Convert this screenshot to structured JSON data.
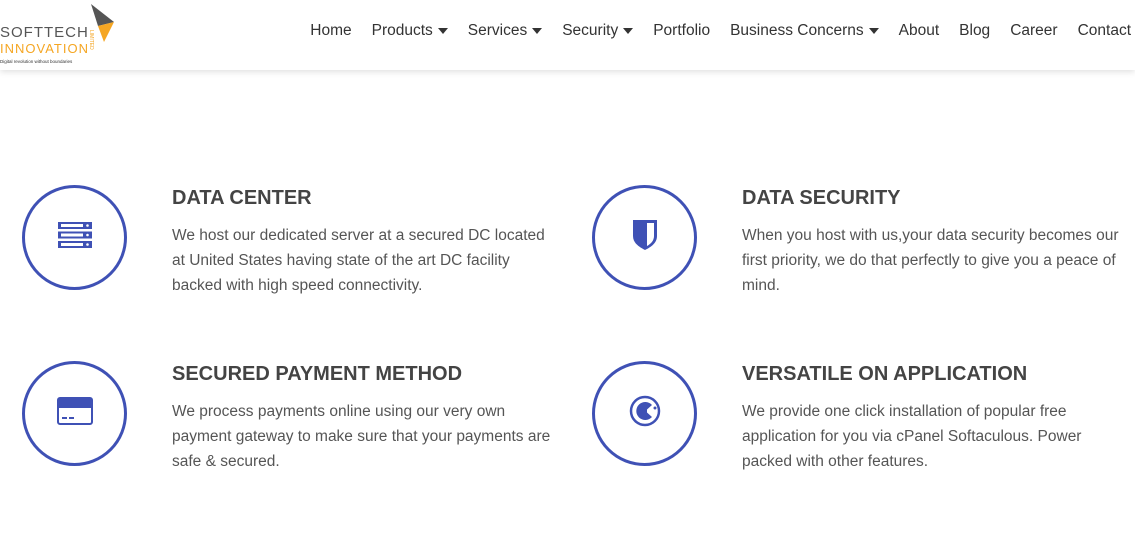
{
  "brand": {
    "name_line1": "SOFTTECH",
    "name_line2": "INNOVATION",
    "suffix": "LIMITED",
    "tagline": "Digital revolution without boundaries",
    "colors": {
      "orange": "#f5a623",
      "gray": "#555555"
    }
  },
  "nav": {
    "items": [
      {
        "label": "Home",
        "dropdown": false
      },
      {
        "label": "Products",
        "dropdown": true
      },
      {
        "label": "Services",
        "dropdown": true
      },
      {
        "label": "Security",
        "dropdown": true
      },
      {
        "label": "Portfolio",
        "dropdown": false
      },
      {
        "label": "Business Concerns",
        "dropdown": true
      },
      {
        "label": "About",
        "dropdown": false
      },
      {
        "label": "Blog",
        "dropdown": false
      },
      {
        "label": "Career",
        "dropdown": false
      },
      {
        "label": "Contact",
        "dropdown": false
      }
    ]
  },
  "accent": "#3f51b5",
  "features": [
    {
      "icon": "server-icon",
      "title": "DATA CENTER",
      "description": "We host our dedicated server at a secured DC located at United States having state of the art DC facility backed with high speed connectivity."
    },
    {
      "icon": "shield-icon",
      "title": "DATA SECURITY",
      "description": "When you host with us,your data security becomes our first priority, we do that perfectly to give you a peace of mind."
    },
    {
      "icon": "credit-card-icon",
      "title": "SECURED PAYMENT METHOD",
      "description": "We process payments online using our very own payment gateway to make sure that your payments are safe & secured."
    },
    {
      "icon": "cpanel-icon",
      "title": "VERSATILE ON APPLICATION",
      "description": "We provide one click installation of popular free application for you via cPanel Softaculous. Power packed with other features."
    }
  ]
}
